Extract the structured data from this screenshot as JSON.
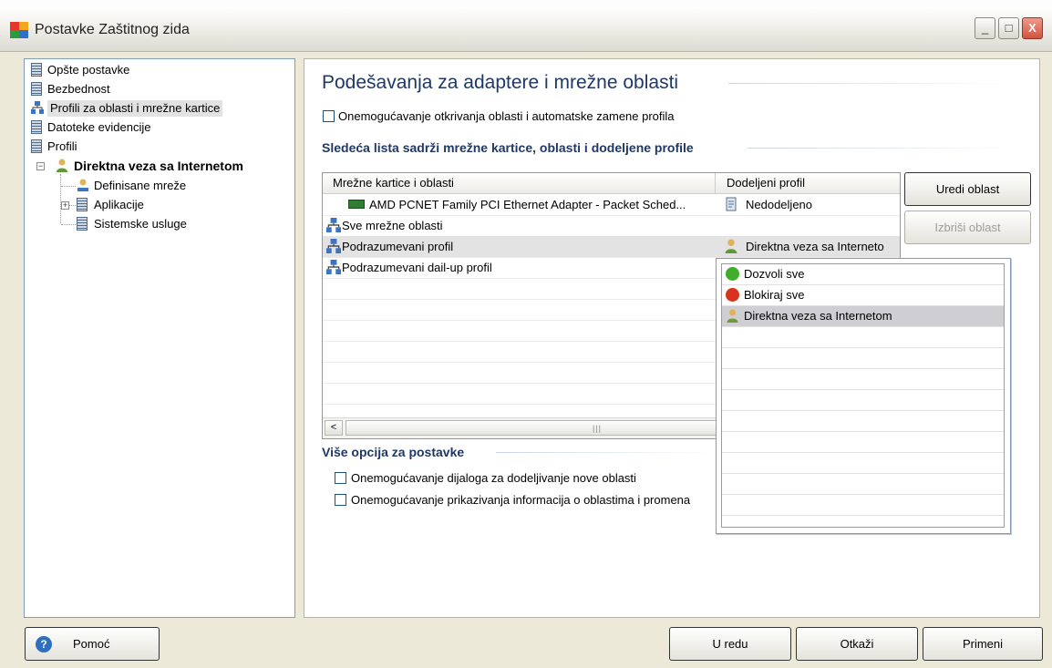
{
  "window": {
    "title": "Postavke Zaštitnog zida",
    "minimize_label": "_",
    "maximize_label": "□",
    "close_label": "X"
  },
  "tree": {
    "items": [
      {
        "label": "Opšte postavke"
      },
      {
        "label": "Bezbednost"
      },
      {
        "label": "Profili za oblasti i mrežne kartice"
      },
      {
        "label": "Datoteke evidencije"
      },
      {
        "label": "Profili"
      },
      {
        "label": "Direktna veza sa Internetom"
      },
      {
        "label": "Definisane mreže"
      },
      {
        "label": "Aplikacije"
      },
      {
        "label": "Sistemske usluge"
      }
    ],
    "expander_minus": "−",
    "expander_plus": "+"
  },
  "panel": {
    "title": "Podešavanja za adaptere i mrežne oblasti",
    "detection_checkbox_label": "Onemogućavanje otkrivanja oblasti i automatske zamene profila",
    "list_section_title": "Sledeća lista sadrži mrežne kartice, oblasti i dodeljene profile",
    "more_options_title": "Više opcija za postavke",
    "option1_label": "Onemogućavanje dijaloga za dodeljivanje nove oblasti",
    "option2_label": "Onemogućavanje prikazivanja informacija o oblastima i promena"
  },
  "grid": {
    "columns": [
      "Mrežne kartice i oblasti",
      "Dodeljeni profil"
    ],
    "rows": [
      {
        "name": "AMD PCNET Family PCI Ethernet Adapter - Packet Sched...",
        "profile": "Nedodeljeno"
      },
      {
        "name": "Sve mrežne oblasti",
        "profile": ""
      },
      {
        "name": "Podrazumevani profil",
        "profile": "Direktna veza sa Interneto"
      },
      {
        "name": "Podrazumevani dail-up profil",
        "profile": ""
      }
    ],
    "scroll_left": "<",
    "scroll_grip": "|||"
  },
  "buttons": {
    "edit_area": "Uredi oblast",
    "delete_area": "Izbriši oblast",
    "help": "Pomoć",
    "ok": "U redu",
    "cancel": "Otkaži",
    "apply": "Primeni"
  },
  "dropdown": {
    "options": [
      {
        "label": "Dozvoli sve",
        "icon": "green-allow-icon",
        "color": "#3fae2a"
      },
      {
        "label": "Blokiraj sve",
        "icon": "red-block-icon",
        "color": "#d8331f"
      },
      {
        "label": "Direktna veza sa Internetom",
        "icon": "person-icon",
        "color": "#6e9a3c"
      }
    ]
  },
  "colors": {
    "heading": "#1f3864",
    "selection": "#e3e3e3",
    "popup_selection": "#cfcfd3"
  }
}
